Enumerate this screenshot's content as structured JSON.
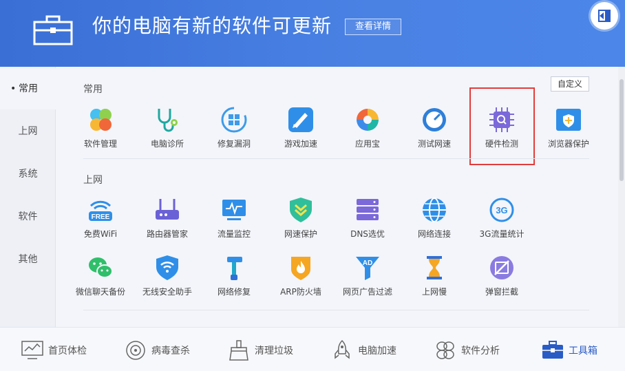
{
  "header": {
    "title": "你的电脑有新的软件可更新",
    "detail_button": "查看详情"
  },
  "sidebar": {
    "items": [
      {
        "label": "常用",
        "active": true
      },
      {
        "label": "上网",
        "active": false
      },
      {
        "label": "系统",
        "active": false
      },
      {
        "label": "软件",
        "active": false
      },
      {
        "label": "其他",
        "active": false
      }
    ]
  },
  "main": {
    "customize_button": "自定义",
    "sections": [
      {
        "title": "常用"
      },
      {
        "title": "上网"
      }
    ],
    "tiles": {
      "common": [
        {
          "label": "软件管理",
          "icon": "clover-icon"
        },
        {
          "label": "电脑诊所",
          "icon": "stethoscope-icon"
        },
        {
          "label": "修复漏洞",
          "icon": "windows-repair-icon"
        },
        {
          "label": "游戏加速",
          "icon": "game-boost-icon"
        },
        {
          "label": "应用宝",
          "icon": "app-store-icon"
        },
        {
          "label": "测试网速",
          "icon": "speedometer-icon"
        },
        {
          "label": "硬件检测",
          "icon": "chip-search-icon"
        },
        {
          "label": "浏览器保护",
          "icon": "browser-shield-icon"
        }
      ],
      "network_row1": [
        {
          "label": "免费WiFi",
          "icon": "free-wifi-icon",
          "badge": "FREE"
        },
        {
          "label": "路由器管家",
          "icon": "router-icon"
        },
        {
          "label": "流量监控",
          "icon": "traffic-monitor-icon"
        },
        {
          "label": "网速保护",
          "icon": "speed-shield-icon"
        },
        {
          "label": "DNS选优",
          "icon": "dns-server-icon"
        },
        {
          "label": "网络连接",
          "icon": "globe-icon"
        },
        {
          "label": "3G流量统计",
          "icon": "3g-icon",
          "badge": "3G"
        }
      ],
      "network_row2": [
        {
          "label": "微信聊天备份",
          "icon": "wechat-icon"
        },
        {
          "label": "无线安全助手",
          "icon": "wifi-shield-icon"
        },
        {
          "label": "网络修复",
          "icon": "hammer-icon"
        },
        {
          "label": "ARP防火墙",
          "icon": "firewall-icon"
        },
        {
          "label": "网页广告过滤",
          "icon": "ad-filter-icon",
          "badge": "AD"
        },
        {
          "label": "上网慢",
          "icon": "hourglass-icon"
        },
        {
          "label": "弹窗拦截",
          "icon": "popup-block-icon"
        }
      ]
    }
  },
  "bottom_nav": [
    {
      "label": "首页体检",
      "icon": "monitor-check-icon",
      "active": false
    },
    {
      "label": "病毒查杀",
      "icon": "target-icon",
      "active": false
    },
    {
      "label": "清理垃圾",
      "icon": "broom-icon",
      "active": false
    },
    {
      "label": "电脑加速",
      "icon": "rocket-icon",
      "active": false
    },
    {
      "label": "软件分析",
      "icon": "fan-icon",
      "active": false
    },
    {
      "label": "工具箱",
      "icon": "toolbox-icon",
      "active": true
    }
  ],
  "colors": {
    "header_blue": "#3a6fd6",
    "active_blue": "#2a5cc6",
    "highlight_red": "#e23b3b"
  }
}
